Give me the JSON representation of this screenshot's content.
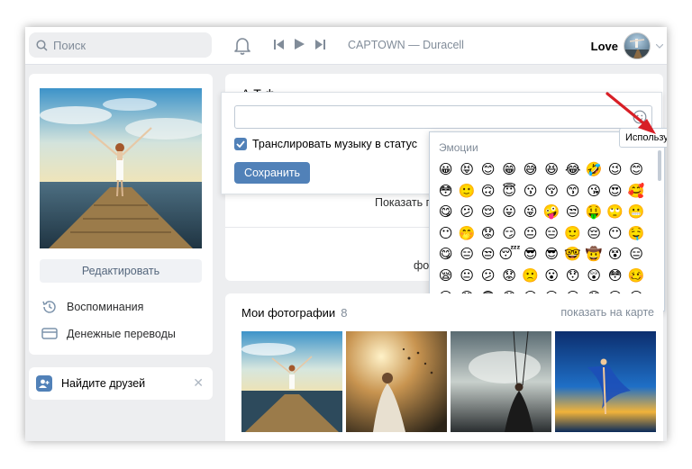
{
  "header": {
    "search_placeholder": "Поиск",
    "now_playing": "CAPTOWN — Duracell",
    "user_name": "Love"
  },
  "profile": {
    "edit_label": "Редактировать",
    "links": [
      {
        "label": "Воспоминания",
        "icon": "history-icon"
      },
      {
        "label": "Денежные переводы",
        "icon": "money-transfer-icon"
      }
    ],
    "find_friends_label": "Найдите друзей",
    "close_glyph": "✕"
  },
  "status": {
    "name_partial": "А    Т    ф",
    "broadcast_music_label": "Транслировать музыку в статус",
    "broadcast_checked": true,
    "save_label": "Сохранить",
    "show_more_partial": "Показать п",
    "photo_partial": "фо"
  },
  "emoji": {
    "title": "Эмоции",
    "tooltip": "Используйте T",
    "rows": [
      [
        "😀",
        "😝",
        "😊",
        "😁",
        "😅",
        "😆",
        "😂",
        "🤣",
        "😉",
        "😊"
      ],
      [
        "😳",
        "🙂",
        "🙃",
        "😇",
        "😗",
        "😚",
        "😙",
        "😘",
        "😍",
        "🥰"
      ],
      [
        "😋",
        "😕",
        "😌",
        "😛",
        "😜",
        "🤪",
        "😒",
        "🤑",
        "🙄",
        "😬"
      ],
      [
        "😶",
        "🤭",
        "😟",
        "😏",
        "😐",
        "😑",
        "🙂",
        "😔",
        "😶",
        "🤤"
      ],
      [
        "😋",
        "😑",
        "😒",
        "😴",
        "😎",
        "😎",
        "🤓",
        "🤠",
        "😵",
        "😑"
      ],
      [
        "😪",
        "😐",
        "😕",
        "😟",
        "🙁",
        "😮",
        "😯",
        "😲",
        "😳",
        "🥴"
      ],
      [
        "😦",
        "😧",
        "😨",
        "😰",
        "😥",
        "😢",
        "😭",
        "😱",
        "😖",
        "😣"
      ]
    ]
  },
  "photos": {
    "title": "Мои фотографии",
    "count": "8",
    "map_link": "показать на карте"
  },
  "colors": {
    "accent": "#5181b8",
    "link": "#2a5885",
    "bg": "#edeef0",
    "arrow": "#d81f26"
  }
}
